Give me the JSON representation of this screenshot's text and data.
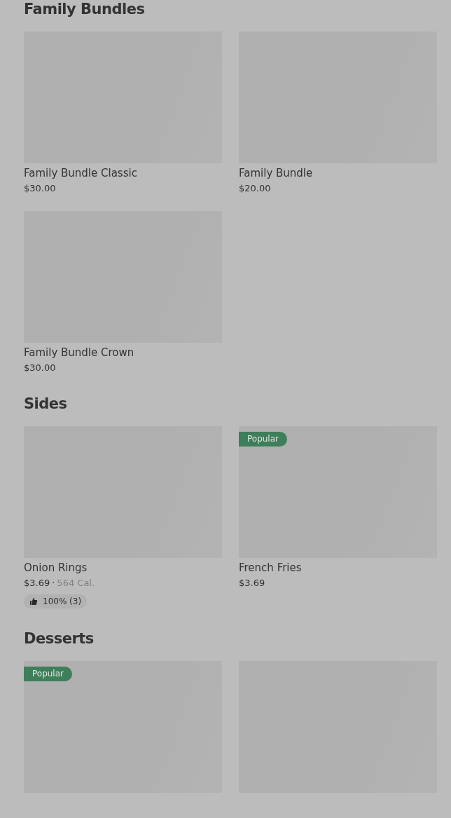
{
  "sections": [
    {
      "title": "Family Bundles",
      "items": [
        {
          "image": {
            "kind": "picture"
          },
          "name": "Family Bundle Classic",
          "price": "$30.00"
        },
        {
          "image": {
            "kind": "picture"
          },
          "name": "Family Bundle",
          "price": "$20.00"
        },
        {
          "image": {
            "kind": "picture"
          },
          "name": "Family Bundle Crown",
          "price": "$30.00"
        }
      ]
    },
    {
      "title": "Sides",
      "items": [
        {
          "image": {
            "kind": "picture"
          },
          "name": "Onion Rings",
          "price": "$3.69",
          "separator": "·",
          "calories": "564 Cal.",
          "rating": "100% (3)"
        },
        {
          "image": {
            "kind": "picture"
          },
          "name": "French Fries",
          "price": "$3.69",
          "badge": "Popular"
        }
      ]
    },
    {
      "title": "Desserts",
      "items": [
        {
          "image": {
            "kind": "picture"
          },
          "badge": "Popular"
        },
        {
          "image": {
            "kind": "picture"
          }
        }
      ]
    }
  ]
}
